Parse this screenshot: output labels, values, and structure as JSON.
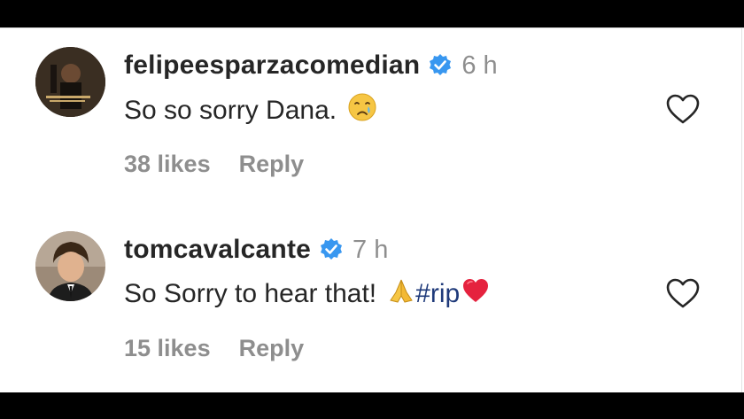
{
  "comments": [
    {
      "username": "felipeesparzacomedian",
      "time": "6 h",
      "text": "So so sorry Dana.",
      "emoji": "crying-face-emoji",
      "likes": "38 likes",
      "reply": "Reply"
    },
    {
      "username": "tomcavalcante",
      "time": "7 h",
      "text": "So Sorry to hear that!",
      "emoji_1": "folded-hands-emoji",
      "hashtag": "#rip",
      "emoji_2": "red-heart-emoji",
      "likes": "15 likes",
      "reply": "Reply"
    }
  ],
  "colors": {
    "verified_badge": "#3897f0",
    "username": "#262626",
    "muted_text": "#8e8e8e",
    "hashtag": "#1f3a7a",
    "heart_outline": "#262626"
  }
}
